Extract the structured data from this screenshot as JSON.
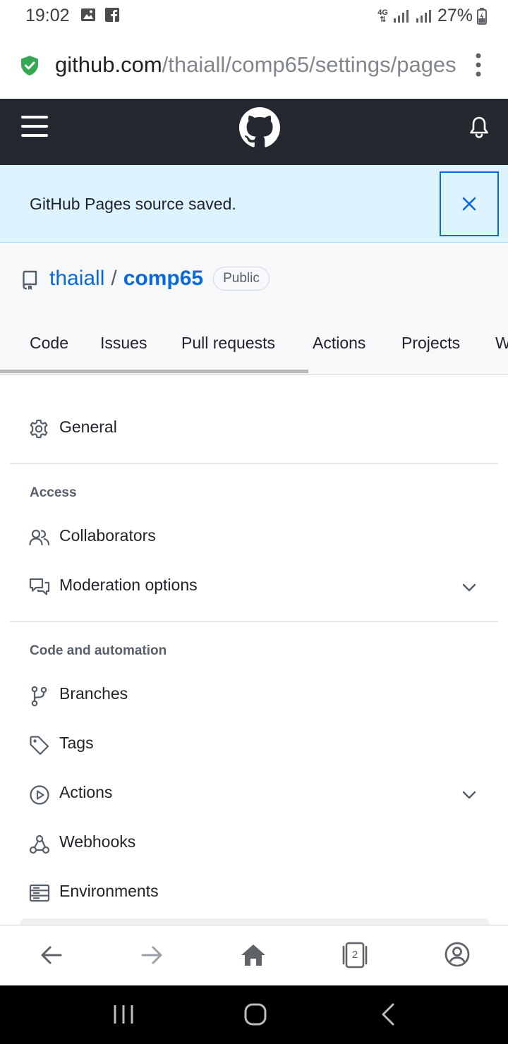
{
  "status_bar": {
    "time": "19:02",
    "network": "4G",
    "battery": "27%"
  },
  "browser": {
    "url_domain": "github.com",
    "url_path": "/thaiall/comp65/settings/pages",
    "tab_count": "2"
  },
  "flash": {
    "message": "GitHub Pages source saved."
  },
  "repo": {
    "owner": "thaiall",
    "separator": "/",
    "name": "comp65",
    "visibility": "Public",
    "tabs": [
      "Code",
      "Issues",
      "Pull requests",
      "Actions",
      "Projects",
      "W"
    ]
  },
  "settings_menu": {
    "general": "General",
    "access": {
      "heading": "Access",
      "items": [
        "Collaborators",
        "Moderation options"
      ]
    },
    "code_automation": {
      "heading": "Code and automation",
      "items": [
        "Branches",
        "Tags",
        "Actions",
        "Webhooks",
        "Environments"
      ]
    }
  },
  "colors": {
    "accent": "#0969da",
    "header_bg": "#24292f",
    "flash_bg": "#ddf4ff",
    "secure_green": "#34a853"
  }
}
